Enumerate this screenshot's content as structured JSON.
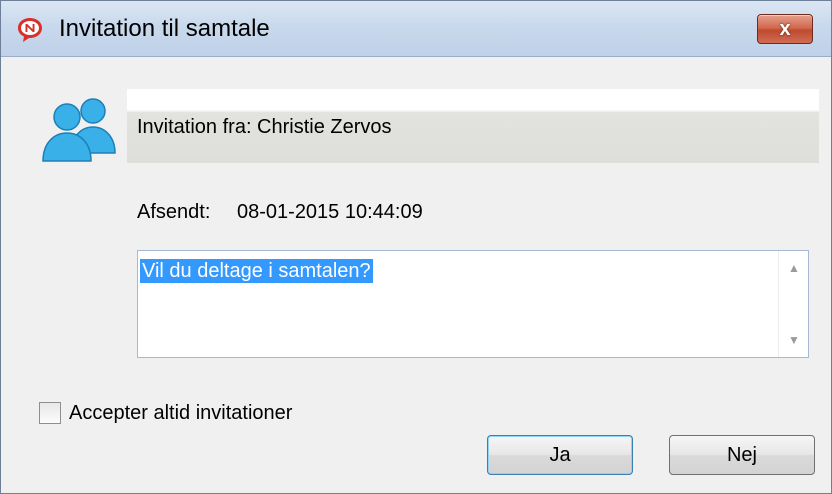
{
  "window": {
    "title": "Invitation til samtale",
    "close_label": "x"
  },
  "invite": {
    "from_text": "Invitation fra: Christie Zervos"
  },
  "sent": {
    "label": "Afsendt:",
    "value": "08-01-2015 10:44:09"
  },
  "message": {
    "text": "Vil du deltage i samtalen?",
    "scroll_up": "▲",
    "scroll_down": "▼"
  },
  "options": {
    "always_accept_label": "Accepter altid invitationer",
    "always_accept_checked": false
  },
  "buttons": {
    "yes_label": "Ja",
    "no_label": "Nej"
  },
  "icons": {
    "app": "app-logo-icon",
    "users": "users-icon",
    "close": "close-icon"
  },
  "colors": {
    "selection": "#3399ff",
    "user_icon": "#3ab0e8",
    "close_button": "#c9573c",
    "logo_red": "#d9302a"
  }
}
